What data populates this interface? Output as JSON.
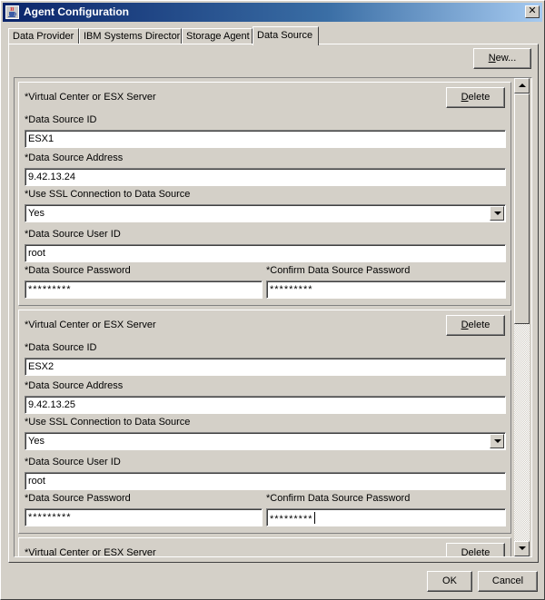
{
  "window": {
    "title": "Agent Configuration",
    "close_label": "✕"
  },
  "tabs": [
    {
      "label": "Data Provider"
    },
    {
      "label": "IBM Systems Director"
    },
    {
      "label": "Storage Agent"
    },
    {
      "label": "Data Source",
      "active": true
    }
  ],
  "toolbar": {
    "new_label_u": "N",
    "new_label_rest": "ew..."
  },
  "labels": {
    "server": "*Virtual Center or ESX Server",
    "ds_id": "*Data Source ID",
    "ds_address": "*Data Source Address",
    "use_ssl": "*Use SSL Connection to Data Source",
    "user_id": "*Data Source User ID",
    "password": "*Data Source Password",
    "confirm_password": "*Confirm Data Source Password",
    "delete_u": "D",
    "delete_rest": "elete"
  },
  "data_sources": [
    {
      "id": "ESX1",
      "address": "9.42.13.24",
      "ssl": "Yes",
      "user": "root",
      "password": "*********",
      "confirm": "*********"
    },
    {
      "id": "ESX2",
      "address": "9.42.13.25",
      "ssl": "Yes",
      "user": "root",
      "password": "*********",
      "confirm": "*********"
    }
  ],
  "footer": {
    "ok_label": "OK",
    "cancel_label": "Cancel"
  },
  "colors": {
    "titlebar_start": "#0a246a",
    "titlebar_end": "#a6caf0",
    "face": "#d4d0c8"
  },
  "icons": {
    "title": "java-cup-icon",
    "close": "close-icon"
  }
}
